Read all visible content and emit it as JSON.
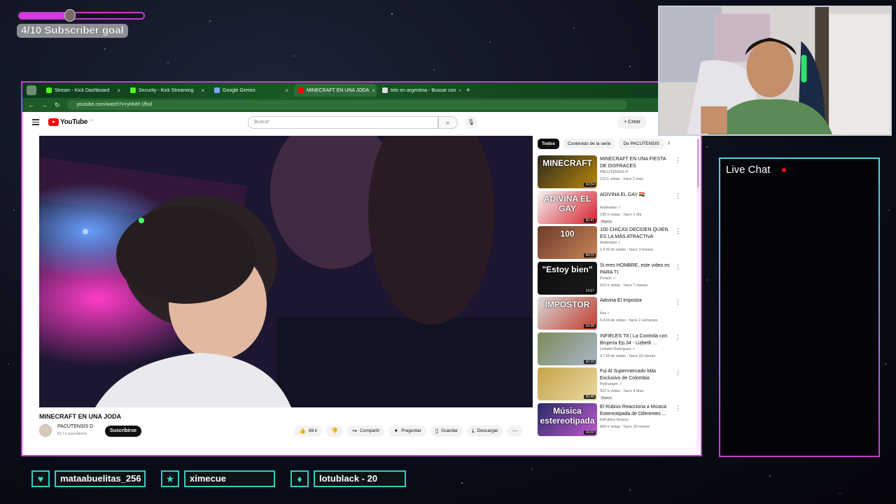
{
  "overlay": {
    "goal_text": "4/10 Subscriber goal",
    "goal_progress": 0.4,
    "live_chat_title": "Live Chat",
    "followers": [
      {
        "name": "mataabuelitas_256",
        "icon": "heart-icon"
      },
      {
        "name": "ximecue",
        "icon": "star-icon"
      },
      {
        "name": "lotublack - 20",
        "icon": "gem-icon"
      }
    ],
    "accent_colors": {
      "magenta": "#c23cd6",
      "teal": "#3ac9c9"
    }
  },
  "browser": {
    "tabs": [
      {
        "label": "Stream - Kick Dashboard",
        "fav_color": "#53fc18"
      },
      {
        "label": "Security - Kick Streaming",
        "fav_color": "#53fc18"
      },
      {
        "label": "Google Gemini",
        "fav_color": "#7aa7ff"
      },
      {
        "label": "MINECRAFT EN UNA JODA",
        "fav_color": "#ff0000"
      },
      {
        "label": "telo en argentina - Buscar con",
        "fav_color": "#dddddd"
      }
    ],
    "active_tab": 3,
    "url": "youtube.com/watch?v=yHnhf-1fhol"
  },
  "youtube": {
    "brand": "YouTube",
    "country": "CO",
    "search_placeholder": "Buscar",
    "create_label": "Crear",
    "video": {
      "title": "MINECRAFT EN UNA JODA",
      "channel": "PACUTENSIS D",
      "subscribers": "81,7 k suscriptores",
      "subscribe_label": "Suscribirse",
      "likes": "66 k",
      "actions": [
        "Compartir",
        "Preguntar",
        "Guardar",
        "Descargar"
      ]
    },
    "chips": [
      "Todos",
      "Contenido de la serie",
      "De PACUTENSIS"
    ],
    "recommendations": [
      {
        "title": "MINECRAFT EN UNA FIESTA DE DISFRACES",
        "channel": "PACUTENSIS D",
        "meta": "112 k vistas · hace 1 mes",
        "duration": "24:34",
        "thumb_text": "MINECRAFT",
        "thumb_colors": [
          "#2c2a1e",
          "#b8860b"
        ],
        "badge": ""
      },
      {
        "title": "ADIVINA EL GAY 🏳️‍🌈",
        "channel": "Ardiestow ✓",
        "meta": "236 k vistas · hace 1 día",
        "duration": "30:41",
        "thumb_text": "ADIVINA EL GAY",
        "thumb_colors": [
          "#f4f4f4",
          "#d81e2a"
        ],
        "badge": "Nuevo"
      },
      {
        "title": "100 CHICAS DECIDEN QUIEN ES LA MÁS ATRACTIVA",
        "channel": "Ardiestow ✓",
        "meta": "1,5 M de vistas · hace 3 meses",
        "duration": "44:15",
        "thumb_text": "100",
        "thumb_colors": [
          "#6b3a28",
          "#c9865a"
        ],
        "badge": ""
      },
      {
        "title": "Si eres HOMBRE, este video es PARA TI",
        "channel": "Prowin ✓",
        "meta": "919 k vistas · hace 7 meses",
        "duration": "14:57",
        "thumb_text": "\"Estoy bien\"",
        "thumb_colors": [
          "#0b0b0b",
          "#1c1c1c"
        ],
        "badge": ""
      },
      {
        "title": "Adivina El Impostor",
        "channel": "Ibai ✓",
        "meta": "5,4 M de vistas · hace 2 semanas",
        "duration": "29:38",
        "thumb_text": "IMPOSTOR",
        "thumb_colors": [
          "#d9d9d9",
          "#c0392b"
        ],
        "badge": ""
      },
      {
        "title": "INFIELES T8 | La Controla con Brujería Ep.34 - Lizbeth ...",
        "channel": "Lizbeth Rodríguez ✓",
        "meta": "3,7 M de vistas · hace 10 meses",
        "duration": "32:18",
        "thumb_text": "",
        "thumb_colors": [
          "#7c8a5a",
          "#a9b7c9"
        ],
        "badge": ""
      },
      {
        "title": "Fui Al Supermercado Más Exclusivo de Colombia",
        "channel": "Pelicanger ✓",
        "meta": "922 k vistas · hace 4 días",
        "duration": "30:48",
        "thumb_text": "",
        "thumb_colors": [
          "#c7a44a",
          "#e8d8a0"
        ],
        "badge": "Nuevo"
      },
      {
        "title": "El Rubius Reacciona a Música Estereotipada de Diferentes ...",
        "channel": "ElRubius Reacts",
        "meta": "899 k vistas · hace 10 meses",
        "duration": "16:00",
        "thumb_text": "Música estereotipada",
        "thumb_colors": [
          "#2a2a66",
          "#c05ad0"
        ],
        "badge": ""
      }
    ]
  }
}
